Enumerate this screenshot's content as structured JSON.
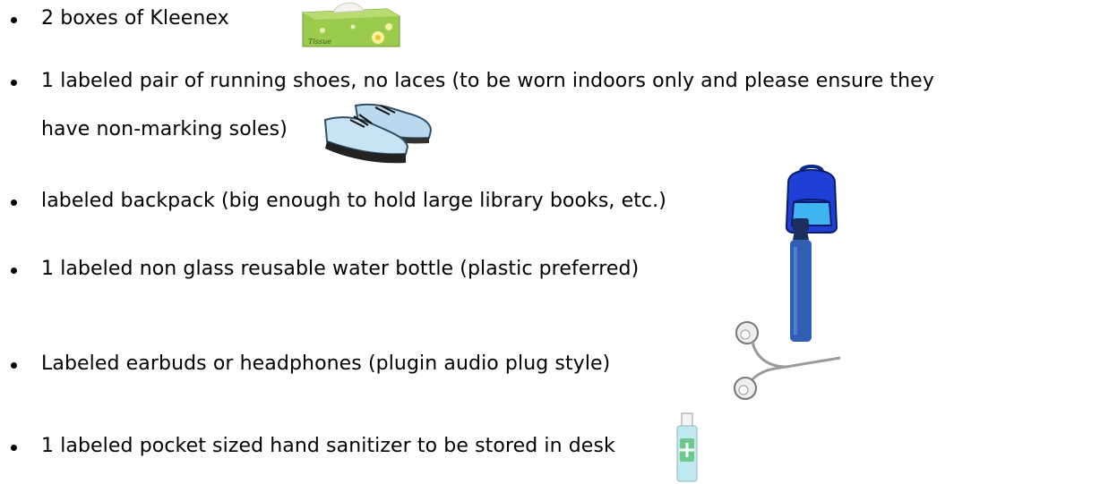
{
  "list": {
    "items": [
      {
        "text": "2 boxes of Kleenex",
        "icon": "tissue-box-icon"
      },
      {
        "text": "1 labeled pair of running shoes, no laces  (to be worn indoors only and please ensure they",
        "text2": "have non-marking soles)",
        "icon": "running-shoes-icon"
      },
      {
        "text": "labeled backpack (big enough to hold large library books, etc.)",
        "icon": "backpack-icon"
      },
      {
        "text": "1 labeled non glass reusable water bottle (plastic preferred)",
        "icon": "water-bottle-icon"
      },
      {
        "text": "Labeled earbuds or headphones (plugin audio plug style)",
        "icon": "earbuds-icon"
      },
      {
        "text": "1 labeled pocket sized hand sanitizer to be stored in desk",
        "icon": "hand-sanitizer-icon"
      }
    ],
    "tissue_label": "Tissue"
  }
}
